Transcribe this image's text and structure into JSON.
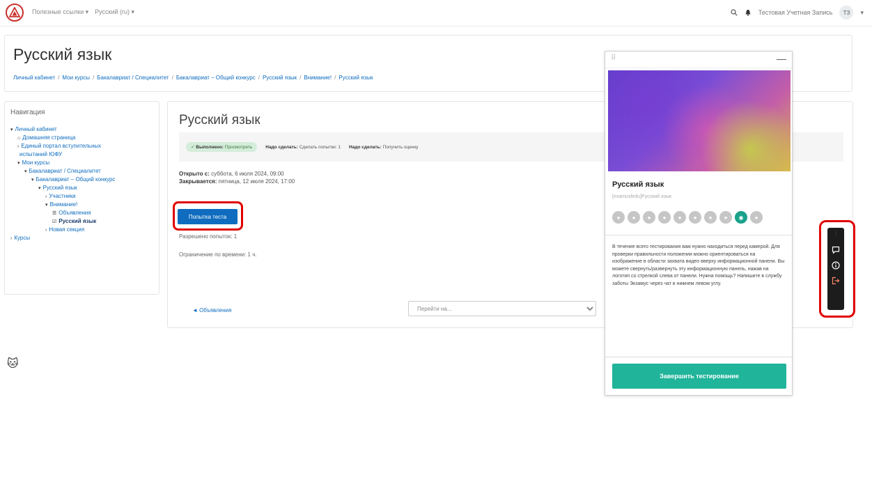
{
  "topbar": {
    "useful_links": "Полезные ссылки",
    "language": "Русский (ru)",
    "user_name": "Тестовая Учетная Запись",
    "user_initials": "ТЗ"
  },
  "header": {
    "title": "Русский язык",
    "breadcrumb": [
      "Личный кабинет",
      "Мои курсы",
      "Бакалавриат / Специалитет",
      "Бакалавриат – Общий конкурс",
      "Русский язык",
      "Внимание!",
      "Русский язык"
    ]
  },
  "navigation": {
    "title": "Навигация",
    "items": [
      {
        "label": "Личный кабинет",
        "level": 0,
        "marker": "v"
      },
      {
        "label": "Домашняя страница",
        "level": 1,
        "marker": "home"
      },
      {
        "label": "Единый портал вступительных",
        "level": 1,
        "marker": ">"
      },
      {
        "label": "испытаний ЮФУ",
        "level": 1,
        "marker": ""
      },
      {
        "label": "Мои курсы",
        "level": 1,
        "marker": "v"
      },
      {
        "label": "Бакалавриат / Специалитет",
        "level": 2,
        "marker": "v"
      },
      {
        "label": "Бакалавриат – Общий конкурс",
        "level": 3,
        "marker": "v"
      },
      {
        "label": "Русский язык",
        "level": 4,
        "marker": "v"
      },
      {
        "label": "Участники",
        "level": 5,
        "marker": ">"
      },
      {
        "label": "Внимание!",
        "level": 5,
        "marker": "v"
      },
      {
        "label": "Объявления",
        "level": 6,
        "marker": "forum"
      },
      {
        "label": "Русский язык",
        "level": 6,
        "marker": "quiz"
      },
      {
        "label": "Новая секция",
        "level": 5,
        "marker": ">"
      },
      {
        "label": "Курсы",
        "level": 0,
        "marker": ">"
      }
    ]
  },
  "main": {
    "title": "Русский язык",
    "completion": {
      "done_label": "Выполнено:",
      "done_value": "Просмотреть",
      "todo1_label": "Надо сделать:",
      "todo1_value": "Сделать попытки: 1",
      "todo2_label": "Надо сделать:",
      "todo2_value": "Получить оценку"
    },
    "opened_label": "Открыто с:",
    "opened_value": "суббота, 6 июля 2024, 09:00",
    "closes_label": "Закрывается:",
    "closes_value": "пятница, 12 июля 2024, 17:00",
    "attempt_button": "Попытка теста",
    "attempts_allowed": "Разрешено попыток: 1",
    "time_limit": "Ограничение по времени: 1 ч.",
    "prev_link": "◄ Объявления",
    "jump_placeholder": "Перейти на..."
  },
  "proctor": {
    "title": "Русский язык",
    "subtitle": "[examusfedu]Русский язык",
    "steps_total": 10,
    "active_step": 9,
    "instructions": "В течение всего тестирования вам нужно находиться перед камерой. Для проверки правильности положения можно ориентироваться на изображение в области захвата видео вверху информационной панели. Вы можете свернуть/развернуть эту информационную панель, нажав на логотип со стрелкой слева от панели. Нужна помощь? Напишите в службу заботы Экзамус через чат в нижнем левом углу.",
    "finish_button": "Завершить тестирование"
  },
  "colors": {
    "link": "#0f6cbf",
    "primary_button": "#0f6cbf",
    "proctor_accent": "#20b49a",
    "highlight": "#e10000",
    "toolbar_bg": "#1c1c1c"
  }
}
